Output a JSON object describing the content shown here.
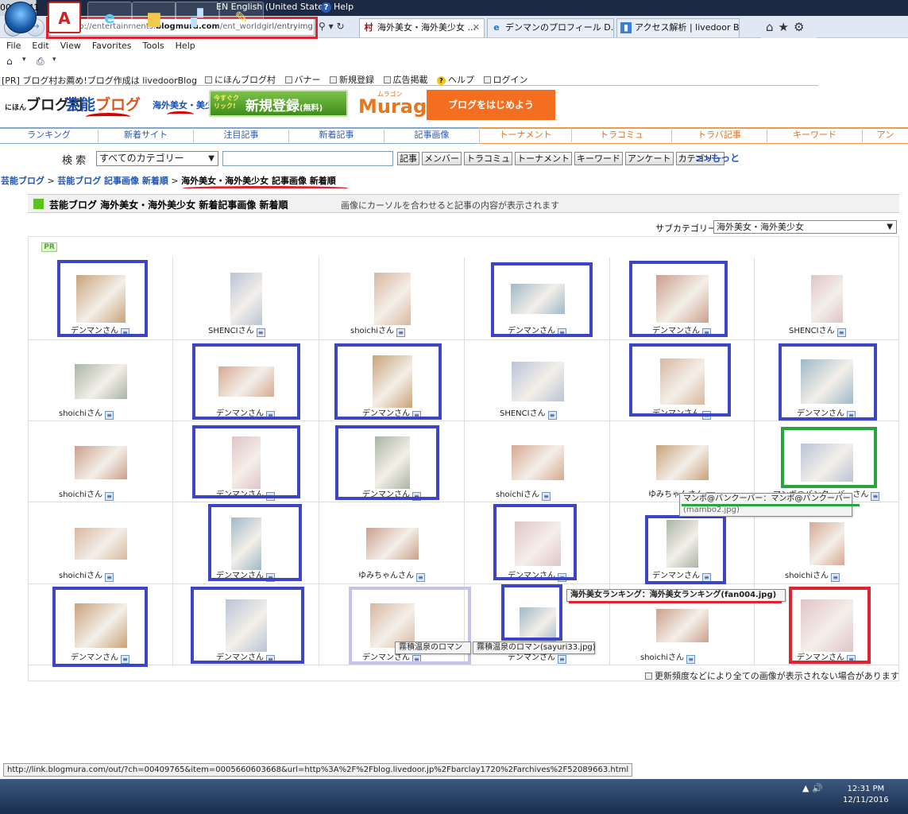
{
  "clock": "00:30:41",
  "language_bar": {
    "lang": "EN English (United States)",
    "help": "Help"
  },
  "browser": {
    "address": {
      "prefix": "http://entertainments.",
      "domain": "blogmura.com",
      "suffix": "/ent_worldgirl/entryimg.html"
    },
    "tabs": [
      {
        "label": "海外美女・海外美少女 ..."
      },
      {
        "label": "デンマンのプロフィール D..."
      },
      {
        "label": "アクセス解析 | livedoor Blog"
      }
    ],
    "menu": [
      "File",
      "Edit",
      "View",
      "Favorites",
      "Tools",
      "Help"
    ]
  },
  "site": {
    "pr_line": "[PR] ブログ村お薦め!ブログ作成は livedoorBlog",
    "top_links": [
      "にほんブログ村",
      "バナー",
      "新規登録",
      "広告掲載",
      "ヘルプ",
      "ログイン"
    ],
    "logo": "ブログ村",
    "logo_small": "にほん",
    "geino_blue": "芸能",
    "geino_orange": "ブログ",
    "kaigai": "海外美女・美少女",
    "signup_small": "今すぐクリック!",
    "signup_big": "新規登録",
    "signup_paren": "(無料)",
    "muragon_kana": "ムラゴン",
    "muragon": "Muragon",
    "start_blog": "ブログをはじめよう",
    "nav": [
      "ランキング",
      "新着サイト",
      "注目記事",
      "新着記事",
      "記事画像",
      "トーナメント",
      "トラコミュ",
      "トラバ記事",
      "キーワード",
      "アン"
    ],
    "search_label": "検 索",
    "category_select": "すべてのカテゴリー",
    "search_buttons": [
      "記事",
      "メンバー",
      "トラコミュ",
      "トーナメント",
      "キーワード",
      "アンケート",
      "カテゴリー"
    ],
    "more": ">>もっと",
    "breadcrumb": [
      "芸能ブログ",
      "芸能ブログ 記事画像 新着順",
      "海外美女・海外美少女 記事画像 新着順"
    ],
    "title": "芸能ブログ 海外美女・海外美少女 新着記事画像 新着順",
    "title_note": "画像にカーソルを合わせると記事の内容が表示されます",
    "subcat_label": "サブカテゴリー",
    "subcat_value": "海外美女・海外美少女",
    "pr_badge": "PR",
    "footer_note": "更新頻度などにより全ての画像が表示されない場合があります"
  },
  "grid_rows": [
    [
      "デンマンさん",
      "SHENCIさん",
      "shoichiさん",
      "デンマンさん",
      "デンマンさん",
      "SHENCIさん"
    ],
    [
      "shoichiさん",
      "デンマンさん",
      "デンマンさん",
      "SHENCIさん",
      "デンマンさん",
      "デンマンさん"
    ],
    [
      "shoichiさん",
      "デンマンさん",
      "デンマンさん",
      "shoichiさん",
      "ゆみちゃんさん",
      "マンボ@バンクーバーさん"
    ],
    [
      "shoichiさん",
      "デンマンさん",
      "ゆみちゃんさん",
      "デンマンさん",
      "デンマンさん",
      "shoichiさん"
    ],
    [
      "デンマンさん",
      "デンマンさん",
      "デンマンさん",
      "デンマンさん",
      "shoichiさん",
      "デンマンさん"
    ]
  ],
  "tooltips": {
    "mambo_title": "マンボ@バンクーバー：マンボ@バンクーバー",
    "mambo_file": "(mambo2.jpg)",
    "kiri_title": "霧積温泉のロマン",
    "kiri_file": "霧積温泉のロマン(sayuri33.jpg)",
    "ranking": "海外美女ランキング：海外美女ランキング(fan004.jpg)"
  },
  "status_url": "http://link.blogmura.com/out/?ch=00409765&item=0005660603668&url=http%3A%2F%2Fblog.livedoor.jp%2Fbarclay1720%2Farchives%2F52089663.html",
  "taskbar": {
    "time": "12:31 PM",
    "date": "12/11/2016"
  },
  "colors": {
    "highlight_blue": "#3d45c4",
    "highlight_green": "#2aa43d",
    "highlight_red": "#e0232f",
    "nav_blue": "#2a5ab0",
    "brand_orange": "#f36f1f"
  }
}
